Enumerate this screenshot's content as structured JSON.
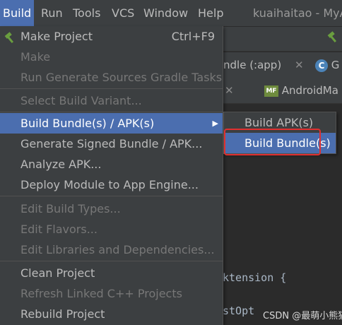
{
  "menubar": {
    "items": [
      {
        "label": "Build"
      },
      {
        "label": "Run"
      },
      {
        "label": "Tools"
      },
      {
        "label": "VCS"
      },
      {
        "label": "Window"
      },
      {
        "label": "Help"
      }
    ],
    "title": "kuaihaitao - MyA"
  },
  "tabs_row1": {
    "tab_label": "ndle (:app)",
    "tab2_label": "G"
  },
  "tabs_row2": {
    "tab_label": "AndroidMa"
  },
  "editor": {
    "line1": "ktension {",
    "line2": "stOpt"
  },
  "watermark": "CSDN @最萌小熊猫",
  "build_menu": {
    "items": [
      {
        "label": "Make Project",
        "shortcut": "Ctrl+F9",
        "state": "enabled"
      },
      {
        "label": "Make",
        "state": "disabled"
      },
      {
        "label": "Run Generate Sources Gradle Tasks",
        "state": "disabled"
      },
      {
        "label": "Select Build Variant...",
        "state": "disabled"
      },
      {
        "label": "Build Bundle(s) / APK(s)",
        "state": "selected",
        "has_submenu": true
      },
      {
        "label": "Generate Signed Bundle / APK...",
        "state": "enabled"
      },
      {
        "label": "Analyze APK...",
        "state": "enabled"
      },
      {
        "label": "Deploy Module to App Engine...",
        "state": "enabled"
      },
      {
        "label": "Edit Build Types...",
        "state": "disabled"
      },
      {
        "label": "Edit Flavors...",
        "state": "disabled"
      },
      {
        "label": "Edit Libraries and Dependencies...",
        "state": "disabled"
      },
      {
        "label": "Clean Project",
        "state": "enabled"
      },
      {
        "label": "Refresh Linked C++ Projects",
        "state": "disabled"
      },
      {
        "label": "Rebuild Project",
        "state": "enabled"
      }
    ]
  },
  "submenu": {
    "items": [
      {
        "label": "Build APK(s)",
        "state": "enabled"
      },
      {
        "label": "Build Bundle(s)",
        "state": "selected"
      }
    ]
  },
  "colors": {
    "menu_bg": "#3c3f41",
    "selection": "#4b6eaf",
    "highlight_box": "#e03030",
    "hammer": "#6a9e3f"
  },
  "icons": {
    "make_project": "hammer-icon",
    "submenu_arrow": "triangle-right-icon"
  }
}
